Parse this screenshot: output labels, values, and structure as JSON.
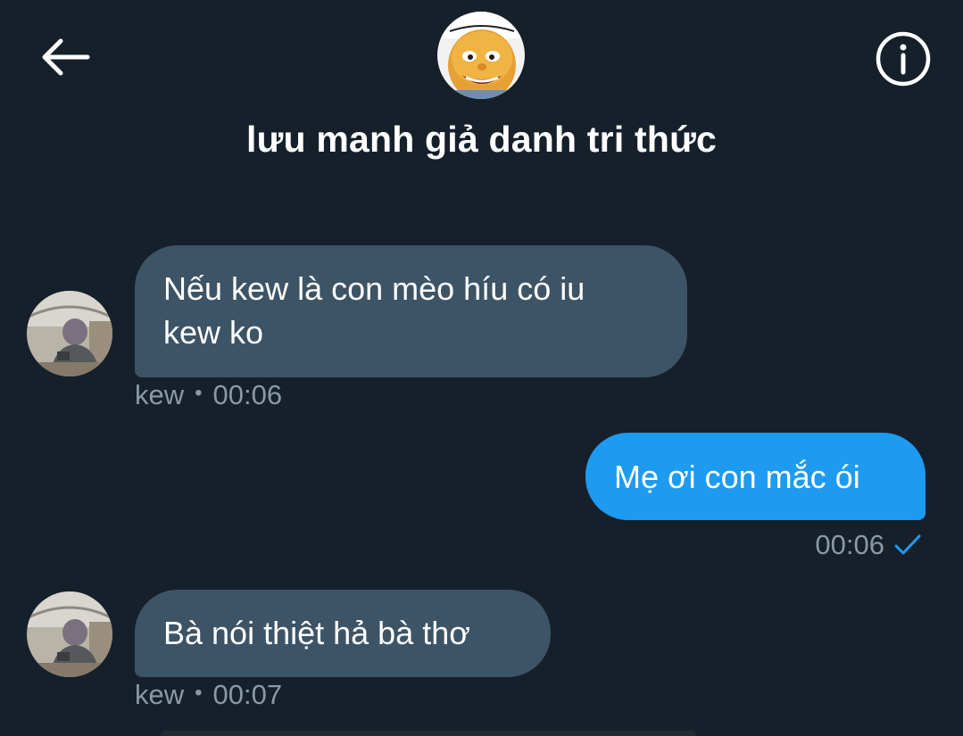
{
  "header": {
    "title": "lưu manh giả danh tri thức"
  },
  "messages": [
    {
      "direction": "incoming",
      "text": "Nếu kew là con mèo híu có iu\nkew ko",
      "sender": "kew",
      "time": "00:06"
    },
    {
      "direction": "outgoing",
      "text": "Mẹ ơi con mắc ói",
      "time": "00:06"
    },
    {
      "direction": "incoming",
      "text": "Bà nói thiệt hả bà thơ",
      "sender": "kew",
      "time": "00:07"
    }
  ],
  "colors": {
    "background": "#15202b",
    "incoming_bubble": "#3d5466",
    "outgoing_bubble": "#1d9bf0",
    "meta_text": "#8b98a5",
    "read_check": "#1d9bf0"
  },
  "icons": {
    "back": "arrow-left-icon",
    "info": "info-circle-icon",
    "read": "checkmark-icon"
  }
}
